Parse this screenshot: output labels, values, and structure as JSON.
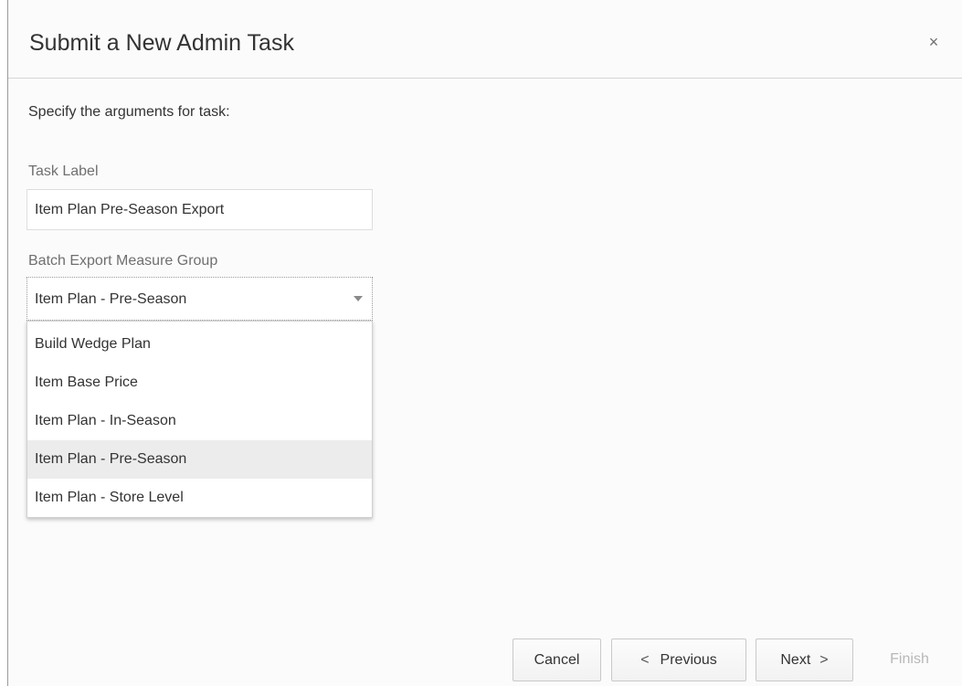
{
  "dialog": {
    "title": "Submit a New Admin Task",
    "close_symbol": "×"
  },
  "instruction": "Specify the arguments for task:",
  "task_label": {
    "label": "Task Label",
    "value": "Item Plan Pre-Season Export"
  },
  "measure_group": {
    "label": "Batch Export Measure Group",
    "selected": "Item Plan - Pre-Season",
    "options": [
      "Build Wedge Plan",
      "Item Base Price",
      "Item Plan - In-Season",
      "Item Plan - Pre-Season",
      "Item Plan - Store Level"
    ]
  },
  "footer": {
    "cancel": "Cancel",
    "previous": "Previous",
    "previous_icon": "<",
    "next": "Next",
    "next_icon": ">",
    "finish": "Finish"
  }
}
